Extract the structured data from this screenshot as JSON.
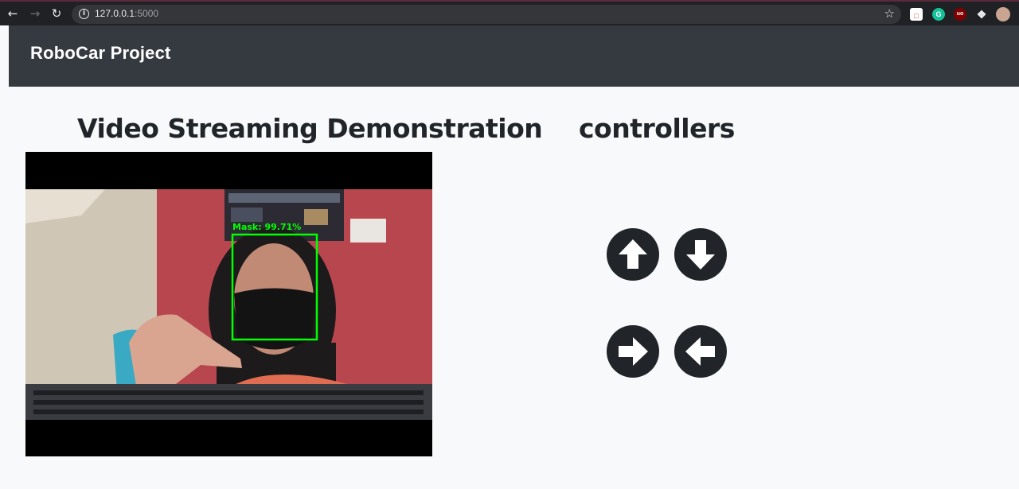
{
  "browser": {
    "url_host": "127.0.0.1",
    "url_port": ":5000"
  },
  "navbar": {
    "brand": "RoboCar Project"
  },
  "video_section": {
    "heading": "Video Streaming Demonstration",
    "detection_label": "Mask: 99.71%",
    "detection_color": "#00ff00"
  },
  "controllers_section": {
    "heading": "controllers",
    "buttons": [
      {
        "name": "forward",
        "icon": "arrow-up-icon"
      },
      {
        "name": "backward",
        "icon": "arrow-down-icon"
      },
      {
        "name": "right",
        "icon": "arrow-right-icon"
      },
      {
        "name": "left",
        "icon": "arrow-left-icon"
      }
    ]
  },
  "colors": {
    "navbar_bg": "#343a40",
    "page_bg": "#f8f9fa",
    "button_bg": "#212529"
  }
}
